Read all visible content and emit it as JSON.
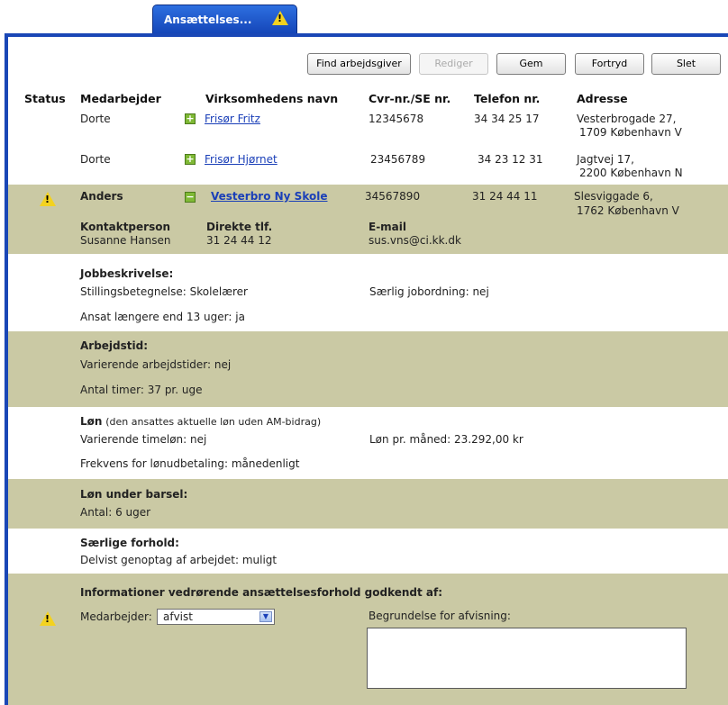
{
  "tab": {
    "label": "Ansættelses...",
    "warning_icon": "warning-icon"
  },
  "toolbar": {
    "find": "Find arbejdsgiver",
    "edit": "Rediger",
    "save": "Gem",
    "undo": "Fortryd",
    "delete": "Slet"
  },
  "columns": {
    "status": "Status",
    "employee": "Medarbejder",
    "company": "Virksomhedens navn",
    "cvr": "Cvr-nr./SE nr.",
    "phone": "Telefon nr.",
    "address": "Adresse"
  },
  "rows": [
    {
      "employee": "Dorte",
      "company": "Frisør Fritz",
      "cvr": "12345678",
      "phone": "34 34 25 17",
      "address1": "Vesterbrogade 27,",
      "address2": "1709 København V"
    },
    {
      "employee": "Dorte",
      "company": "Frisør Hjørnet",
      "cvr": "23456789",
      "phone": "34 23 12 31",
      "address1": "Jagtvej 17,",
      "address2": "2200 København N"
    },
    {
      "employee": "Anders",
      "company": "Vesterbro Ny Skole",
      "cvr": "34567890",
      "phone": "31 24 44 11",
      "address1": "Slesviggade 6,",
      "address2": "1762 København V"
    }
  ],
  "contact": {
    "person_label": "Kontaktperson",
    "person": "Susanne Hansen",
    "phone_label": "Direkte tlf.",
    "phone": "31 24 44 12",
    "email_label": "E-mail",
    "email": "sus.vns@ci.kk.dk"
  },
  "job": {
    "title": "Jobbeskrivelse:",
    "position_label": "Stillingsbetegnelse:",
    "position": "Skolelærer",
    "special_label": "Særlig jobordning:",
    "special": "nej",
    "longer_label": "Ansat længere end 13 uger:",
    "longer": "ja"
  },
  "worktime": {
    "title": "Arbejdstid:",
    "varying_label": "Varierende arbejdstider:",
    "varying": "nej",
    "hours_label": "Antal timer:",
    "hours": "37 pr. uge"
  },
  "salary": {
    "title": "Løn",
    "note": "(den ansattes aktuelle løn uden AM-bidrag)",
    "varying_label": "Varierende timeløn:",
    "varying": "nej",
    "monthly_label": "Løn pr. måned:",
    "monthly": "23.292,00 kr",
    "freq_label": "Frekvens for lønudbetaling:",
    "freq": "månedenligt"
  },
  "leave": {
    "title": "Løn under barsel:",
    "count_label": "Antal:",
    "count": "6 uger"
  },
  "special": {
    "title": "Særlige forhold:",
    "resume_label": "Delvist genoptag af arbejdet:",
    "resume": "muligt"
  },
  "approval": {
    "title": "Informationer vedrørende ansættelsesforhold godkendt af:",
    "employee_label": "Medarbejder:",
    "employee_value": "afvist",
    "reason_label": "Begrundelse for afvisning:",
    "reason_value": ""
  },
  "colors": {
    "accent": "#1a47b6",
    "band": "#cac9a4",
    "link": "#1a3fb8",
    "warning": "#f3d21f"
  }
}
